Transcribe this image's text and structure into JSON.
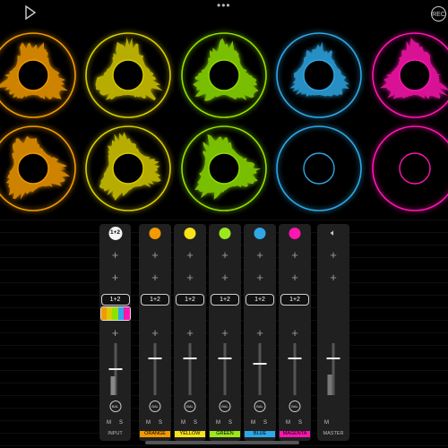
{
  "topbar": {
    "menu_dots": "•••",
    "rec_label": "REC"
  },
  "pads": {
    "columns": [
      {
        "name": "orange",
        "color": "#f39a00"
      },
      {
        "name": "yellow",
        "color": "#d8cc00"
      },
      {
        "name": "green",
        "color": "#8fe000"
      },
      {
        "name": "blue",
        "color": "#2ea8e6"
      },
      {
        "name": "magenta",
        "color": "#ff16b0"
      }
    ]
  },
  "mixer": {
    "input": {
      "top_label": "1+2",
      "route": "1+2",
      "balance": "BAL",
      "mute": "M",
      "solo": "S",
      "label": "INPUT",
      "strip_colors": [
        "#f39a00",
        "#d8cc00",
        "#8fe000",
        "#2ea8e6",
        "#ff16b0"
      ],
      "fader": 0.52
    },
    "channels": [
      {
        "name": "orange-channel",
        "color": "#f39a00",
        "route": "1+2",
        "balance": "BAL",
        "mute": "M",
        "solo": "S",
        "label": "ORANGE",
        "fader": 0.72
      },
      {
        "name": "yellow-channel",
        "color": "#f6e31a",
        "route": "1+2",
        "balance": "BAL",
        "mute": "M",
        "solo": "S",
        "label": "YELLOW",
        "fader": 0.72
      },
      {
        "name": "green-channel",
        "color": "#9be81e",
        "route": "1+2",
        "balance": "BAL",
        "mute": "M",
        "solo": "S",
        "label": "GREEN",
        "fader": 0.72
      },
      {
        "name": "blue-channel",
        "color": "#2ea8e6",
        "route": "1+2",
        "balance": "BAL",
        "mute": "M",
        "solo": "S",
        "label": "BLUE",
        "fader": 0.62
      },
      {
        "name": "magenta-channel",
        "color": "#ff16b0",
        "route": "1+2",
        "balance": "BAL",
        "mute": "M",
        "solo": "S",
        "label": "MAGENTA",
        "fader": 0.72
      }
    ],
    "master": {
      "mute": "M",
      "label": "MASTER",
      "fader": 0.72
    }
  }
}
